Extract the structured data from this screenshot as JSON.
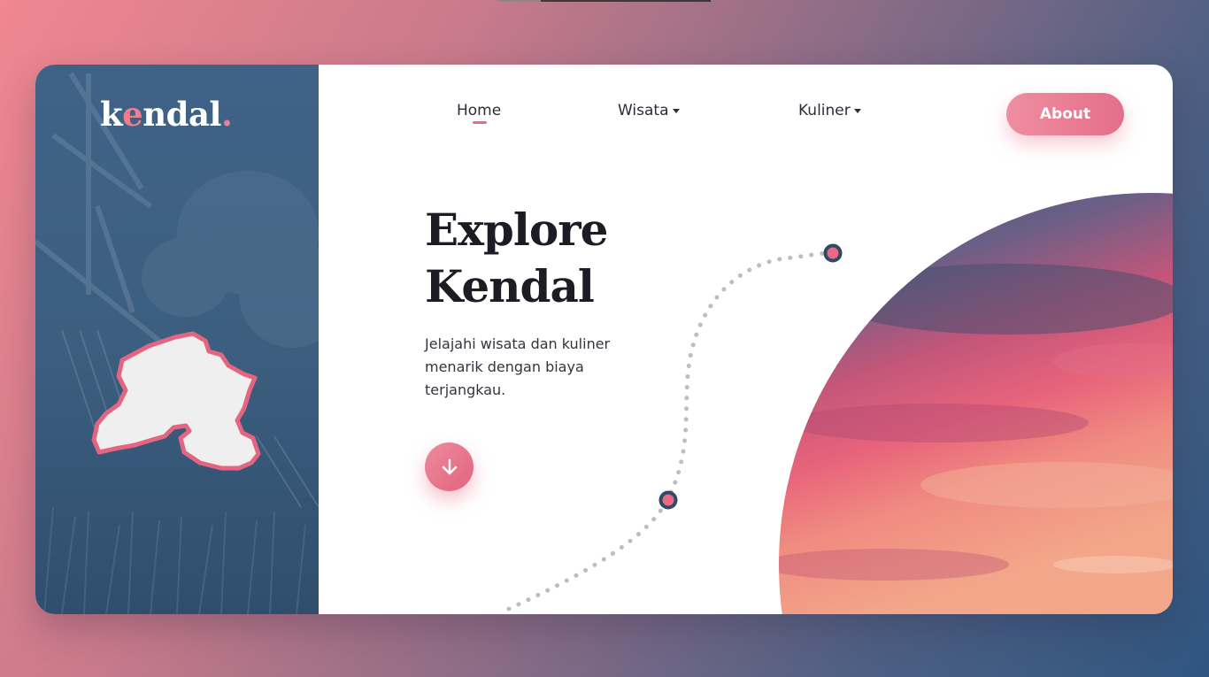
{
  "logo": {
    "prefix": "k",
    "accent": "e",
    "suffix": "ndal",
    "dot": "."
  },
  "nav": {
    "items": [
      {
        "label": "Home",
        "active": true
      },
      {
        "label": "Wisata",
        "dropdown": true
      },
      {
        "label": "Kuliner",
        "dropdown": true
      }
    ],
    "about_label": "About"
  },
  "hero": {
    "title_line1": "Explore",
    "title_line2": "Kendal",
    "description": "Jelajahi wisata dan kuliner menarik dengan biaya terjangkau."
  },
  "icons": {
    "scroll_down": "arrow-down-icon",
    "map": "kendal-map-icon",
    "dropdown": "caret-down-icon"
  },
  "colors": {
    "accent": "#e96b83",
    "sidebar": "#3c5f80",
    "text": "#1c1c24"
  }
}
